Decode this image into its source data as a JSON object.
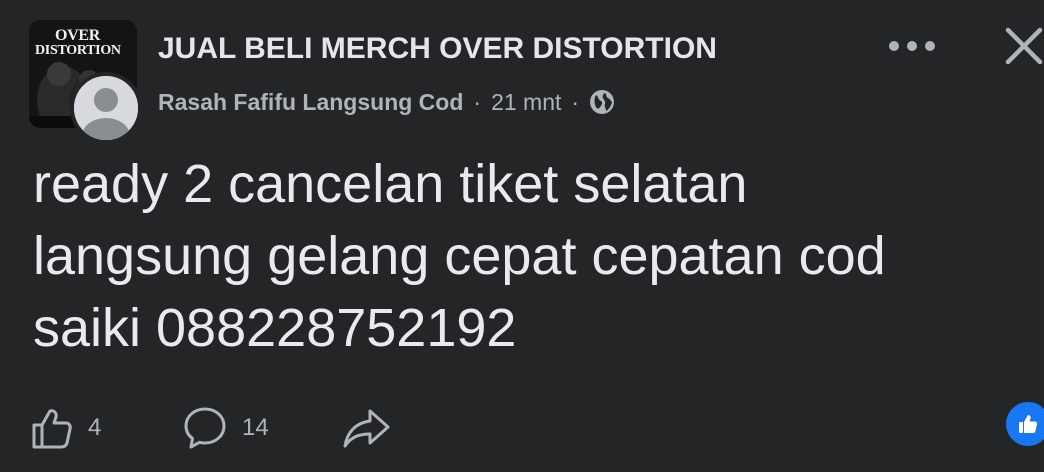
{
  "group": {
    "name": "JUAL BELI MERCH OVER DISTORTION",
    "logo_line1": "OVER",
    "logo_line2": "DISTORTION"
  },
  "post": {
    "author": "Rasah Fafifu Langsung Cod",
    "separator": "·",
    "time": "21 mnt",
    "text": "ready 2 cancelan tiket selatan\nlangsung gelang cepat cepatan cod\nsaiki 088228752192",
    "privacy_icon": "globe-icon"
  },
  "actions": {
    "like_count": "4",
    "comment_count": "14",
    "like_icon": "thumbs-up-icon",
    "comment_icon": "comment-icon",
    "share_icon": "share-icon"
  },
  "colors": {
    "background": "#242526",
    "text_primary": "#e4e6eb",
    "text_secondary": "#b0b3b8",
    "accent": "#1877f2"
  }
}
